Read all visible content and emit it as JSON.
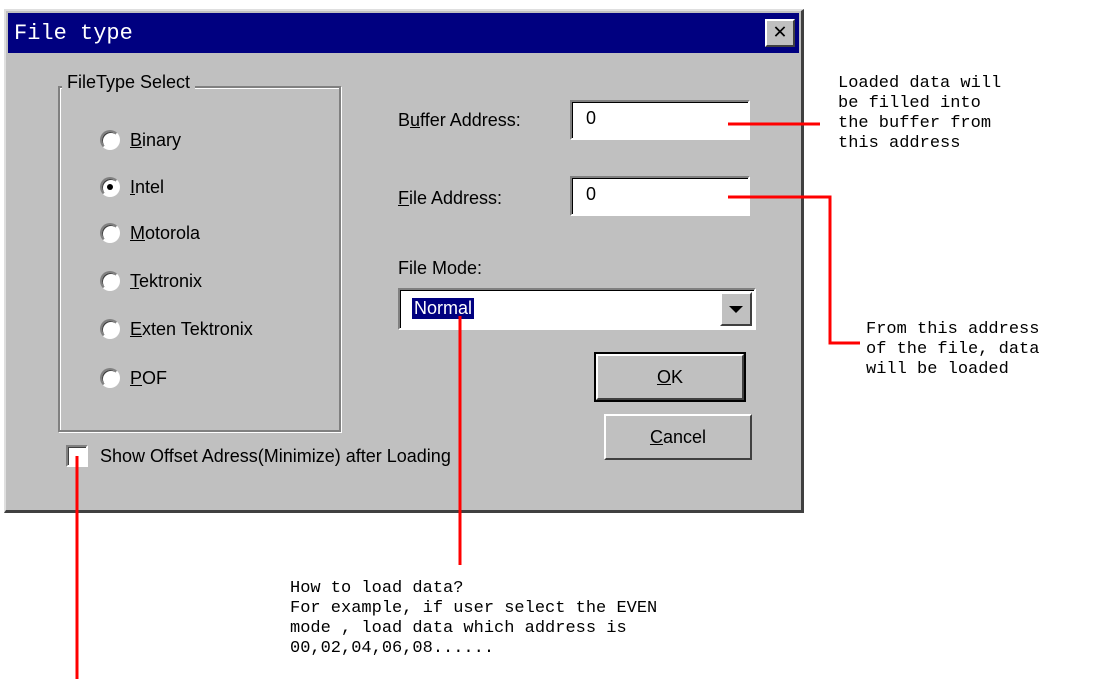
{
  "window": {
    "title": "File type",
    "close_label": "✕"
  },
  "filetype_group": {
    "legend": "FileType Select",
    "options": [
      {
        "underline": "B",
        "rest": "inary",
        "checked": false
      },
      {
        "underline": "I",
        "rest": "ntel",
        "checked": true
      },
      {
        "underline": "M",
        "rest": "otorola",
        "checked": false
      },
      {
        "underline": "T",
        "rest": "ektronix",
        "checked": false
      },
      {
        "underline": "E",
        "rest": "xten Tektronix",
        "checked": false
      },
      {
        "underline": "P",
        "rest": "OF",
        "checked": false
      }
    ]
  },
  "buffer_address": {
    "label_pre": "B",
    "label_u": "u",
    "label_post": "ffer Address:",
    "value": "0"
  },
  "file_address": {
    "label_u": "F",
    "label_post": "ile Address:",
    "value": "0"
  },
  "file_mode": {
    "label": "File Mode:",
    "value": "Normal"
  },
  "buttons": {
    "ok_u": "O",
    "ok_rest": "K",
    "cancel_u": "C",
    "cancel_rest": "ancel"
  },
  "show_offset": {
    "label": "Show Offset Adress(Minimize) after Loading",
    "checked": false
  },
  "annotations": {
    "buffer": "Loaded data will\nbe filled into\nthe buffer from\nthis address",
    "file_address": "From this address\nof the file, data\nwill be loaded",
    "file_mode": "How to load data?\nFor example, if user select the EVEN\nmode , load data which address is\n00,02,04,06,08......"
  },
  "colors": {
    "dialog_bg": "#c0c0c0",
    "titlebar": "#000080",
    "annotation_line": "#ff0000"
  }
}
